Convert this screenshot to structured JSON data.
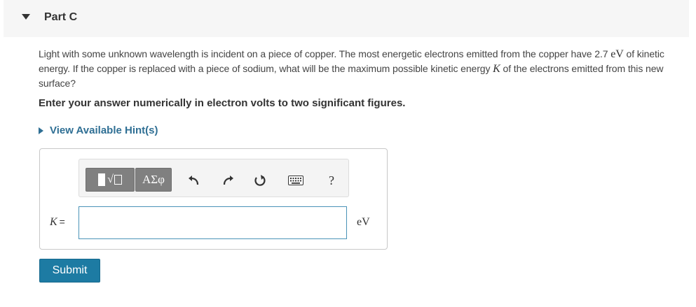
{
  "part": {
    "title": "Part C"
  },
  "question": {
    "text_1": "Light with some unknown wavelength is incident on a piece of copper. The most energetic electrons emitted from the copper have 2.7",
    "unit_ev": "eV",
    "text_2": " of kinetic energy. If the copper is replaced with a piece of sodium, what will be the maximum possible kinetic energy ",
    "var_k": "K",
    "text_3": " of the electrons emitted from this new surface?"
  },
  "instruction": "Enter your answer numerically in electron volts to two significant figures.",
  "hint": {
    "label": "View Available Hint(s)"
  },
  "toolbar": {
    "symbols_label": "ΑΣφ",
    "help_label": "?",
    "icons": [
      "templates-icon",
      "symbols-icon",
      "undo-icon",
      "redo-icon",
      "reset-icon",
      "keyboard-icon",
      "help-icon"
    ]
  },
  "answer": {
    "variable": "K",
    "equals": "=",
    "value": "",
    "placeholder": "",
    "unit": "eV"
  },
  "submit": {
    "label": "Submit"
  },
  "colors": {
    "link": "#2f6f94",
    "submit_bg": "#1d7ba3",
    "input_border": "#4a93b8",
    "toolbar_button": "#808080"
  }
}
